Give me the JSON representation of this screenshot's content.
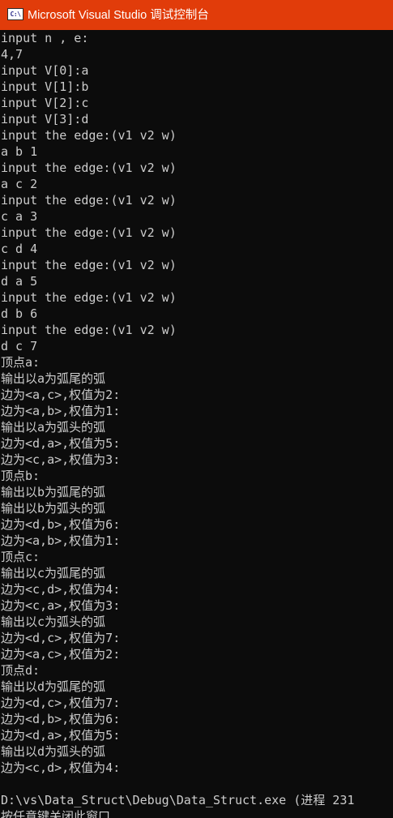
{
  "window": {
    "title": "Microsoft Visual Studio 调试控制台",
    "icon_name": "console-app-icon",
    "icon_glyph": "C:\\",
    "titlebar_color": "#e13c0a",
    "background_color": "#0c0c0c",
    "text_color": "#cccccc"
  },
  "console": {
    "lines": [
      "input n , e:",
      "4,7",
      "input V[0]:a",
      "input V[1]:b",
      "input V[2]:c",
      "input V[3]:d",
      "input the edge:(v1 v2 w)",
      "a b 1",
      "input the edge:(v1 v2 w)",
      "a c 2",
      "input the edge:(v1 v2 w)",
      "c a 3",
      "input the edge:(v1 v2 w)",
      "c d 4",
      "input the edge:(v1 v2 w)",
      "d a 5",
      "input the edge:(v1 v2 w)",
      "d b 6",
      "input the edge:(v1 v2 w)",
      "d c 7",
      "顶点a:",
      "输出以a为弧尾的弧",
      "边为<a,c>,权值为2:",
      "边为<a,b>,权值为1:",
      "输出以a为弧头的弧",
      "边为<d,a>,权值为5:",
      "边为<c,a>,权值为3:",
      "顶点b:",
      "输出以b为弧尾的弧",
      "输出以b为弧头的弧",
      "边为<d,b>,权值为6:",
      "边为<a,b>,权值为1:",
      "顶点c:",
      "输出以c为弧尾的弧",
      "边为<c,d>,权值为4:",
      "边为<c,a>,权值为3:",
      "输出以c为弧头的弧",
      "边为<d,c>,权值为7:",
      "边为<a,c>,权值为2:",
      "顶点d:",
      "输出以d为弧尾的弧",
      "边为<d,c>,权值为7:",
      "边为<d,b>,权值为6:",
      "边为<d,a>,权值为5:",
      "输出以d为弧头的弧",
      "边为<c,d>,权值为4:",
      "",
      "D:\\vs\\Data_Struct\\Debug\\Data_Struct.exe (进程 231",
      "按任意键关闭此窗口"
    ]
  }
}
